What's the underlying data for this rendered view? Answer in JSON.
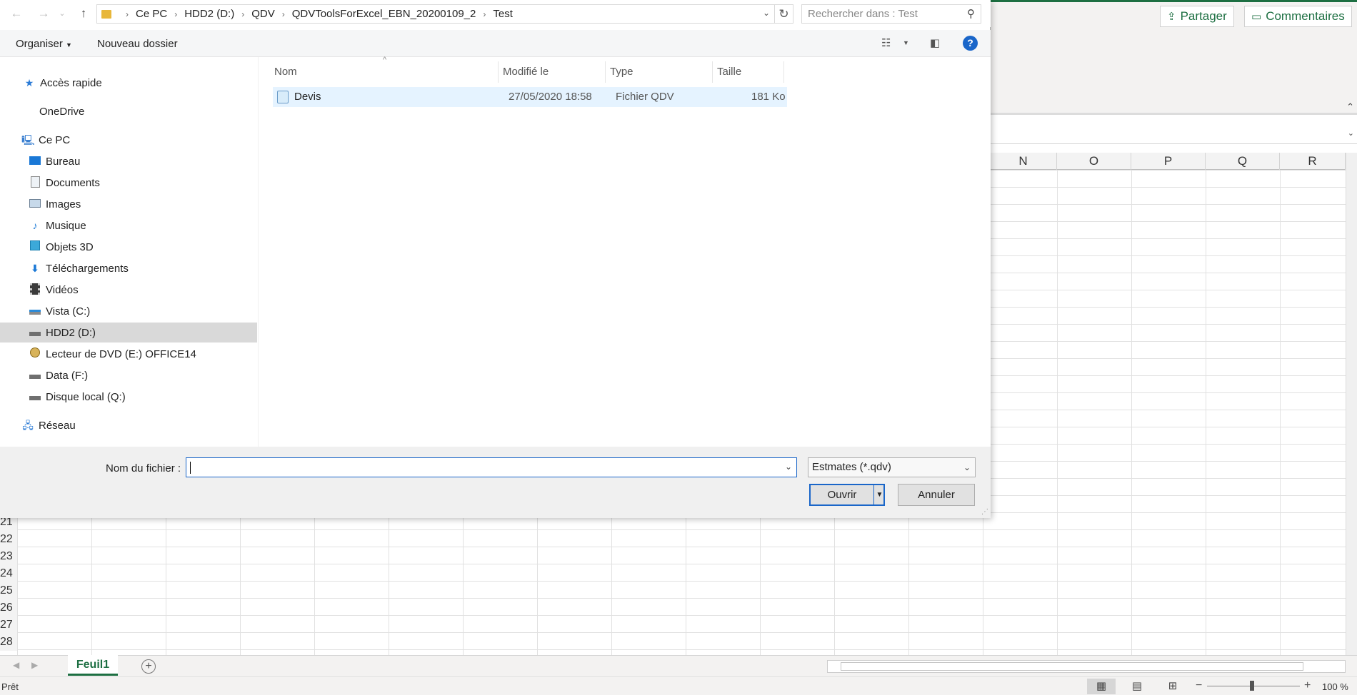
{
  "excel": {
    "share_label": "Partager",
    "comments_label": "Commentaires",
    "columns": [
      "N",
      "O",
      "P",
      "Q",
      "R"
    ],
    "rows": [
      "21",
      "22",
      "23",
      "24",
      "25",
      "26",
      "27",
      "28"
    ],
    "sheet_tab": "Feuil1",
    "add_sheet": "+",
    "status": "Prêt",
    "zoom_minus": "−",
    "zoom_plus": "+",
    "zoom": "100 %"
  },
  "dialog": {
    "path": [
      "Ce PC",
      "HDD2 (D:)",
      "QDV",
      "QDVToolsForExcel_EBN_20200109_2",
      "Test"
    ],
    "search_placeholder": "Rechercher dans : Test",
    "toolbar": {
      "organize": "Organiser",
      "new_folder": "Nouveau dossier"
    },
    "nav": [
      {
        "label": "Accès rapide",
        "icon": "star-icon"
      },
      {
        "label": "OneDrive",
        "icon": "cloud-icon"
      },
      {
        "label": "Ce PC",
        "icon": "computer-icon"
      },
      {
        "label": "Bureau",
        "icon": "desktop-icon"
      },
      {
        "label": "Documents",
        "icon": "documents-icon"
      },
      {
        "label": "Images",
        "icon": "images-icon"
      },
      {
        "label": "Musique",
        "icon": "music-icon"
      },
      {
        "label": "Objets 3D",
        "icon": "cube-icon"
      },
      {
        "label": "Téléchargements",
        "icon": "download-icon"
      },
      {
        "label": "Vidéos",
        "icon": "video-icon"
      },
      {
        "label": "Vista (C:)",
        "icon": "drive-icon"
      },
      {
        "label": "HDD2 (D:)",
        "icon": "drive-icon"
      },
      {
        "label": "Lecteur de DVD (E:) OFFICE14",
        "icon": "dvd-icon"
      },
      {
        "label": "Data (F:)",
        "icon": "drive-icon"
      },
      {
        "label": "Disque local (Q:)",
        "icon": "drive-icon"
      },
      {
        "label": "Réseau",
        "icon": "network-icon"
      }
    ],
    "columns": {
      "name": "Nom",
      "modified": "Modifié le",
      "type": "Type",
      "size": "Taille"
    },
    "files": [
      {
        "name": "Devis",
        "modified": "27/05/2020 18:58",
        "type": "Fichier QDV",
        "size": "181 Ko"
      }
    ],
    "filename_label": "Nom du fichier :",
    "filename_value": "",
    "filetype": "Estmates (*.qdv)",
    "open_label": "Ouvrir",
    "cancel_label": "Annuler"
  },
  "colors": {
    "accent": "#1a66c9",
    "excel_green": "#1d6f42",
    "selection": "#e5f3ff"
  }
}
